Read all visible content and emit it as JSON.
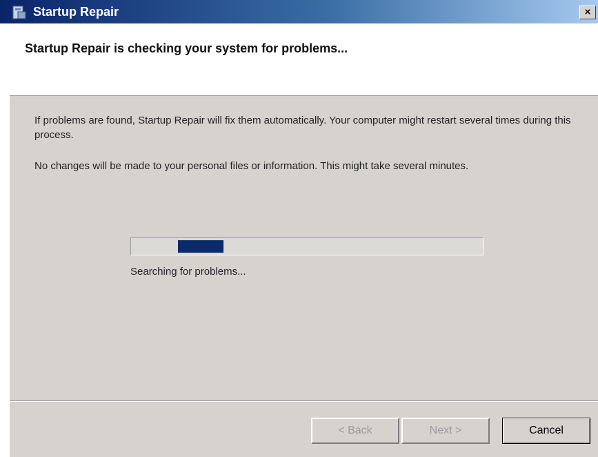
{
  "window": {
    "title": "Startup Repair",
    "close_label": "×"
  },
  "header": {
    "heading": "Startup Repair is checking your system for problems..."
  },
  "body": {
    "paragraph1": "If problems are found, Startup Repair will fix them automatically. Your computer might restart several times during this process.",
    "paragraph2": "No changes will be made to your personal files or information. This might take several minutes."
  },
  "progress": {
    "status_text": "Searching for problems...",
    "mode": "indeterminate"
  },
  "buttons": {
    "back": "< Back",
    "next": "Next >",
    "cancel": "Cancel"
  },
  "colors": {
    "titlebar_start": "#0a246a",
    "titlebar_end": "#a6caf0",
    "progress_chunk": "#0a2a6a",
    "dialog_background": "#d6d3ce"
  },
  "icons": {
    "app_icon": "startup-repair-icon",
    "close": "close-icon"
  }
}
